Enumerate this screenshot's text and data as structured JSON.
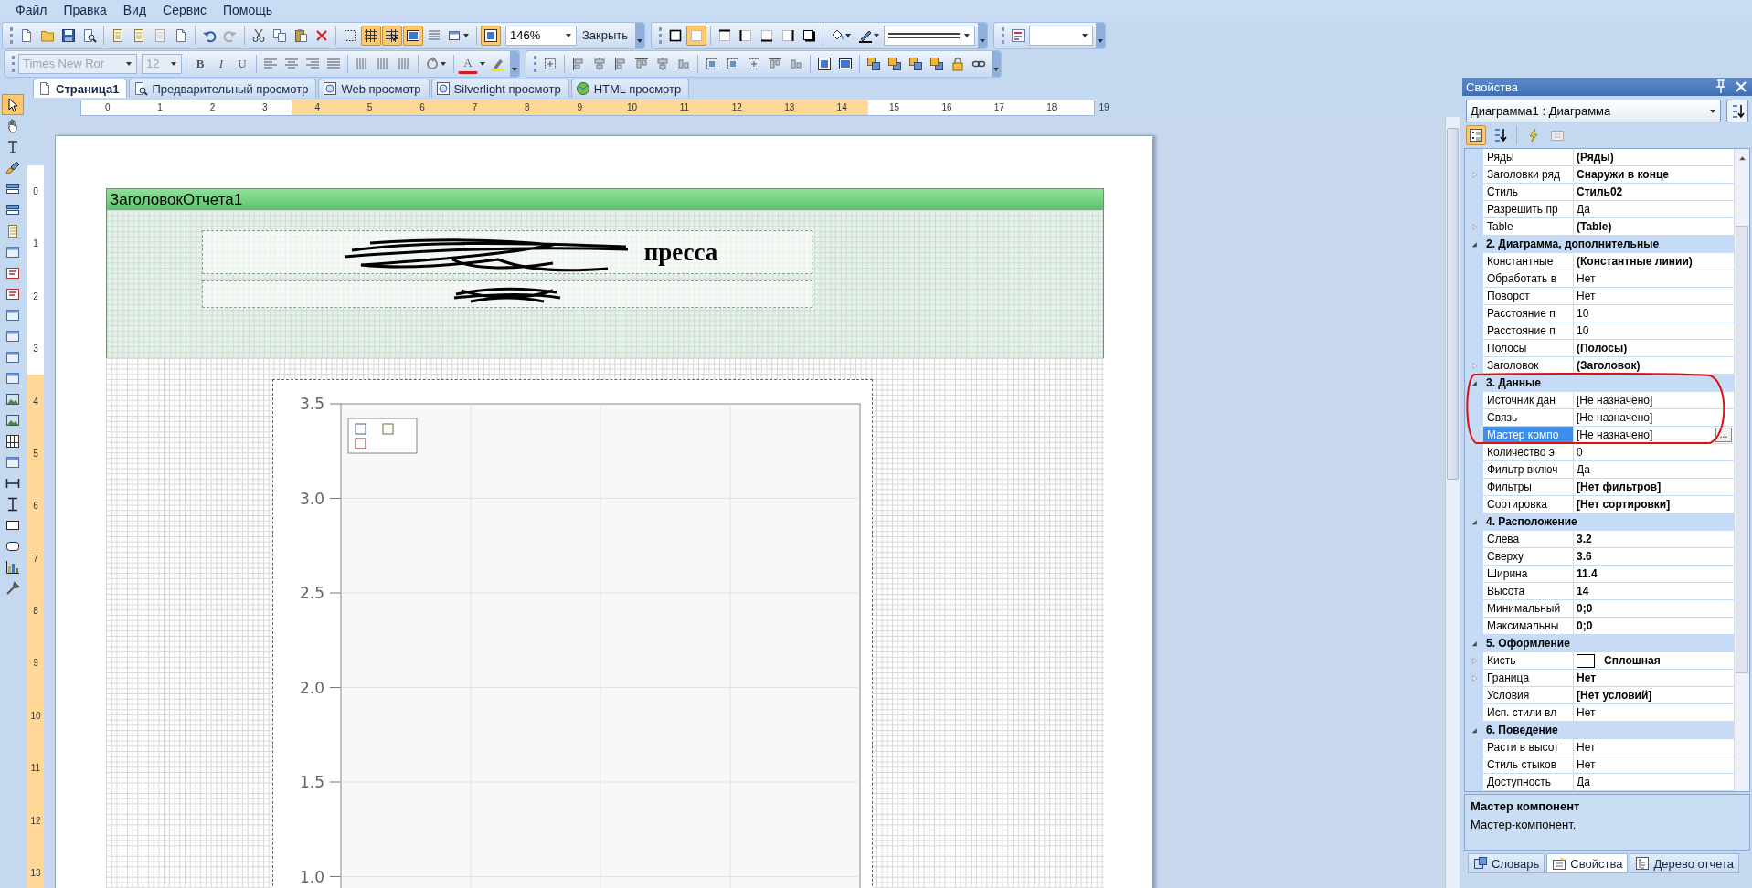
{
  "menu": [
    "Файл",
    "Правка",
    "Вид",
    "Сервис",
    "Помощь"
  ],
  "toolbar": {
    "toggles": [
      {
        "on": true
      },
      {
        "on": true
      },
      {
        "on": true
      },
      {
        "on": true
      },
      {
        "on": false
      },
      {
        "on": true
      }
    ],
    "zoom": "146%",
    "close_button": "Закрыть",
    "font": {
      "value": "Times New Ror",
      "disabled": true
    },
    "font_size": {
      "value": "12",
      "disabled": true
    },
    "format_buttons": [
      "B",
      "I",
      "U"
    ],
    "font_color_button": "A"
  },
  "toolbox": [
    {
      "selected": true
    },
    {
      "selected": false
    },
    {
      "selected": false
    },
    {
      "selected": false
    },
    {
      "selected": false
    },
    {
      "selected": false
    },
    {
      "selected": false
    },
    {
      "selected": false
    },
    {
      "selected": false
    },
    {
      "selected": false
    },
    {
      "selected": false
    },
    {
      "selected": false
    },
    {
      "selected": false
    },
    {
      "selected": false
    },
    {
      "selected": false
    },
    {
      "selected": false
    },
    {
      "selected": false
    },
    {
      "selected": false
    },
    {
      "selected": false
    },
    {
      "selected": false
    },
    {
      "selected": false
    },
    {
      "selected": false
    },
    {
      "selected": false
    },
    {
      "selected": false
    }
  ],
  "tabs": [
    {
      "label": "Страница1",
      "selected": true
    },
    {
      "label": "Предварительный просмотр",
      "selected": false
    },
    {
      "label": "Web просмотр",
      "selected": false
    },
    {
      "label": "Silverlight просмотр",
      "selected": false
    },
    {
      "label": "HTML просмотр",
      "selected": false
    }
  ],
  "ruler_horizontal": [
    {
      "label": "0",
      "highlighted": false
    },
    {
      "label": "1",
      "highlighted": false
    },
    {
      "label": "2",
      "highlighted": false
    },
    {
      "label": "3",
      "highlighted": false
    },
    {
      "label": "4",
      "highlighted": true
    },
    {
      "label": "5",
      "highlighted": true
    },
    {
      "label": "6",
      "highlighted": true
    },
    {
      "label": "7",
      "highlighted": true
    },
    {
      "label": "8",
      "highlighted": true
    },
    {
      "label": "9",
      "highlighted": true
    },
    {
      "label": "10",
      "highlighted": true
    },
    {
      "label": "11",
      "highlighted": true
    },
    {
      "label": "12",
      "highlighted": true
    },
    {
      "label": "13",
      "highlighted": true
    },
    {
      "label": "14",
      "highlighted": true
    },
    {
      "label": "15",
      "highlighted": false
    },
    {
      "label": "16",
      "highlighted": false
    },
    {
      "label": "17",
      "highlighted": false
    },
    {
      "label": "18",
      "highlighted": false
    },
    {
      "label": "19",
      "highlighted": false
    }
  ],
  "ruler_vertical": [
    {
      "label": "0",
      "highlighted": false
    },
    {
      "label": "1",
      "highlighted": false
    },
    {
      "label": "2",
      "highlighted": false
    },
    {
      "label": "3",
      "highlighted": false
    },
    {
      "label": "4",
      "highlighted": true
    },
    {
      "label": "5",
      "highlighted": true
    },
    {
      "label": "6",
      "highlighted": true
    },
    {
      "label": "7",
      "highlighted": true
    },
    {
      "label": "8",
      "highlighted": true
    },
    {
      "label": "9",
      "highlighted": true
    },
    {
      "label": "10",
      "highlighted": true
    },
    {
      "label": "11",
      "highlighted": true
    },
    {
      "label": "12",
      "highlighted": true
    },
    {
      "label": "13",
      "highlighted": true
    }
  ],
  "report": {
    "band_title": "ЗаголовокОтчета1",
    "title_visible_text": "пресса",
    "chart": {
      "chart_data": {
        "type": "line",
        "ylim": [
          0.93,
          3.5
        ],
        "grid": true,
        "series": [
          {
            "color": "#3f5f8f"
          },
          {
            "color": "#6e6e3a"
          },
          {
            "color": "#7a2c2c"
          }
        ],
        "yticks": [
          {
            "value": 3.5,
            "label": "3.5"
          },
          {
            "value": 3,
            "label": "3.0"
          },
          {
            "value": 2.5,
            "label": "2.5"
          },
          {
            "value": 2,
            "label": "2.0"
          },
          {
            "value": 1.5,
            "label": "1.5"
          },
          {
            "value": 1,
            "label": "1.0"
          }
        ]
      }
    }
  },
  "properties": {
    "title": "Свойства",
    "object_selector": "Диаграмма1 : Диаграмма",
    "rows": [
      {
        "kind": "property",
        "name": "Ряды",
        "value": "(Ряды)",
        "bold": true,
        "expandable": false,
        "selected": false
      },
      {
        "kind": "property",
        "name": "Заголовки ряд",
        "value": "Снаружи в конце",
        "bold": true,
        "expandable": true,
        "selected": false
      },
      {
        "kind": "property",
        "name": "Стиль",
        "value": "Стиль02",
        "bold": true,
        "expandable": false,
        "selected": false
      },
      {
        "kind": "property",
        "name": "Разрешить пр",
        "value": "Да",
        "bold": false,
        "expandable": false,
        "selected": false
      },
      {
        "kind": "property",
        "name": "Table",
        "value": "(Table)",
        "bold": true,
        "expandable": true,
        "selected": false
      },
      {
        "kind": "category",
        "label": "2. Диаграмма, дополнительные",
        "expanded": true
      },
      {
        "kind": "property",
        "name": "Константные",
        "value": "(Константные линии)",
        "bold": true,
        "expandable": false,
        "selected": false
      },
      {
        "kind": "property",
        "name": "Обработать в",
        "value": "Нет",
        "bold": false,
        "expandable": false,
        "selected": false
      },
      {
        "kind": "property",
        "name": "Поворот",
        "value": "Нет",
        "bold": false,
        "expandable": false,
        "selected": false
      },
      {
        "kind": "property",
        "name": "Расстояние п",
        "value": "10",
        "bold": false,
        "expandable": false,
        "selected": false
      },
      {
        "kind": "property",
        "name": "Расстояние п",
        "value": "10",
        "bold": false,
        "expandable": false,
        "selected": false
      },
      {
        "kind": "property",
        "name": "Полосы",
        "value": "(Полосы)",
        "bold": true,
        "expandable": false,
        "selected": false
      },
      {
        "kind": "property",
        "name": "Заголовок",
        "value": "(Заголовок)",
        "bold": true,
        "expandable": true,
        "selected": false
      },
      {
        "kind": "category",
        "label": "3. Данные",
        "expanded": true
      },
      {
        "kind": "property",
        "name": "Источник дан",
        "value": "[Не назначено]",
        "bold": false,
        "expandable": false,
        "selected": false
      },
      {
        "kind": "property",
        "name": "Связь",
        "value": "[Не назначено]",
        "bold": false,
        "expandable": false,
        "selected": false
      },
      {
        "kind": "property",
        "name": "Мастер компо",
        "value": "[Не назначено]",
        "bold": false,
        "expandable": false,
        "selected": true,
        "button": "..."
      },
      {
        "kind": "property",
        "name": "Количество э",
        "value": "0",
        "bold": false,
        "expandable": false,
        "selected": false
      },
      {
        "kind": "property",
        "name": "Фильтр включ",
        "value": "Да",
        "bold": false,
        "expandable": false,
        "selected": false
      },
      {
        "kind": "property",
        "name": "Фильтры",
        "value": "[Нет фильтров]",
        "bold": true,
        "expandable": false,
        "selected": false
      },
      {
        "kind": "property",
        "name": "Сортировка",
        "value": "[Нет сортировки]",
        "bold": true,
        "expandable": false,
        "selected": false
      },
      {
        "kind": "category",
        "label": "4. Расположение",
        "expanded": true
      },
      {
        "kind": "property",
        "name": "Слева",
        "value": "3.2",
        "bold": true,
        "expandable": false,
        "selected": false
      },
      {
        "kind": "property",
        "name": "Сверху",
        "value": "3.6",
        "bold": true,
        "expandable": false,
        "selected": false
      },
      {
        "kind": "property",
        "name": "Ширина",
        "value": "11.4",
        "bold": true,
        "expandable": false,
        "selected": false
      },
      {
        "kind": "property",
        "name": "Высота",
        "value": "14",
        "bold": true,
        "expandable": false,
        "selected": false
      },
      {
        "kind": "property",
        "name": "Минимальный",
        "value": "0;0",
        "bold": true,
        "expandable": false,
        "selected": false
      },
      {
        "kind": "property",
        "name": "Максимальны",
        "value": "0;0",
        "bold": true,
        "expandable": false,
        "selected": false
      },
      {
        "kind": "category",
        "label": "5. Оформление",
        "expanded": true
      },
      {
        "kind": "brush",
        "name": "Кисть",
        "value": "Сплошная",
        "bold": true,
        "expandable": true,
        "selected": false
      },
      {
        "kind": "property",
        "name": "Граница",
        "value": "Нет",
        "bold": true,
        "expandable": true,
        "selected": false
      },
      {
        "kind": "property",
        "name": "Условия",
        "value": "[Нет условий]",
        "bold": true,
        "expandable": false,
        "selected": false
      },
      {
        "kind": "property",
        "name": "Исп. стили вл",
        "value": "Нет",
        "bold": false,
        "expandable": false,
        "selected": false
      },
      {
        "kind": "category",
        "label": "6. Поведение",
        "expanded": true
      },
      {
        "kind": "property",
        "name": "Расти в высот",
        "value": "Нет",
        "bold": false,
        "expandable": false,
        "selected": false
      },
      {
        "kind": "property",
        "name": "Стиль стыков",
        "value": "Нет",
        "bold": false,
        "expandable": false,
        "selected": false
      },
      {
        "kind": "property",
        "name": "Доступность",
        "value": "Да",
        "bold": false,
        "expandable": false,
        "selected": false
      }
    ],
    "description": {
      "title": "Мастер компонент",
      "text": "Мастер-компонент."
    },
    "bottom_tabs": [
      {
        "label": "Словарь",
        "selected": false
      },
      {
        "label": "Свойства",
        "selected": true
      },
      {
        "label": "Дерево отчета",
        "selected": false
      }
    ]
  }
}
